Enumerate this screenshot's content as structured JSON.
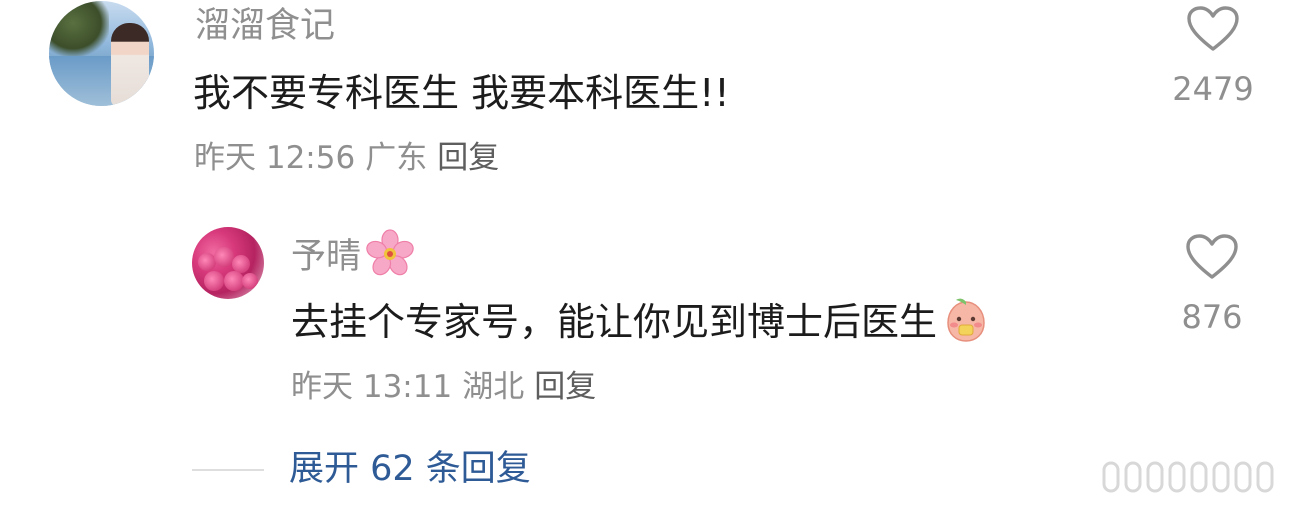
{
  "comments": [
    {
      "username": "溜溜食记",
      "text": "我不要专科医生 我要本科医生!!",
      "time": "昨天 12:56",
      "location": "广东",
      "reply_label": "回复",
      "likes": "2479",
      "avatar_icon": "avatar-lakeside-woman"
    }
  ],
  "reply": {
    "username": "予晴",
    "username_emoji": "cherry-blossom-icon",
    "text": "去挂个专家号，能让你见到博士后医生",
    "text_emoji": "peach-face-emoji",
    "time": "昨天 13:11",
    "location": "湖北",
    "reply_label": "回复",
    "likes": "876",
    "avatar_icon": "avatar-pink-roses"
  },
  "expand_replies": "展开 62 条回复",
  "colors": {
    "name": "#8f8f8f",
    "text": "#1c1c1c",
    "link": "#2e5a96",
    "heart": "#8f8f8f"
  }
}
